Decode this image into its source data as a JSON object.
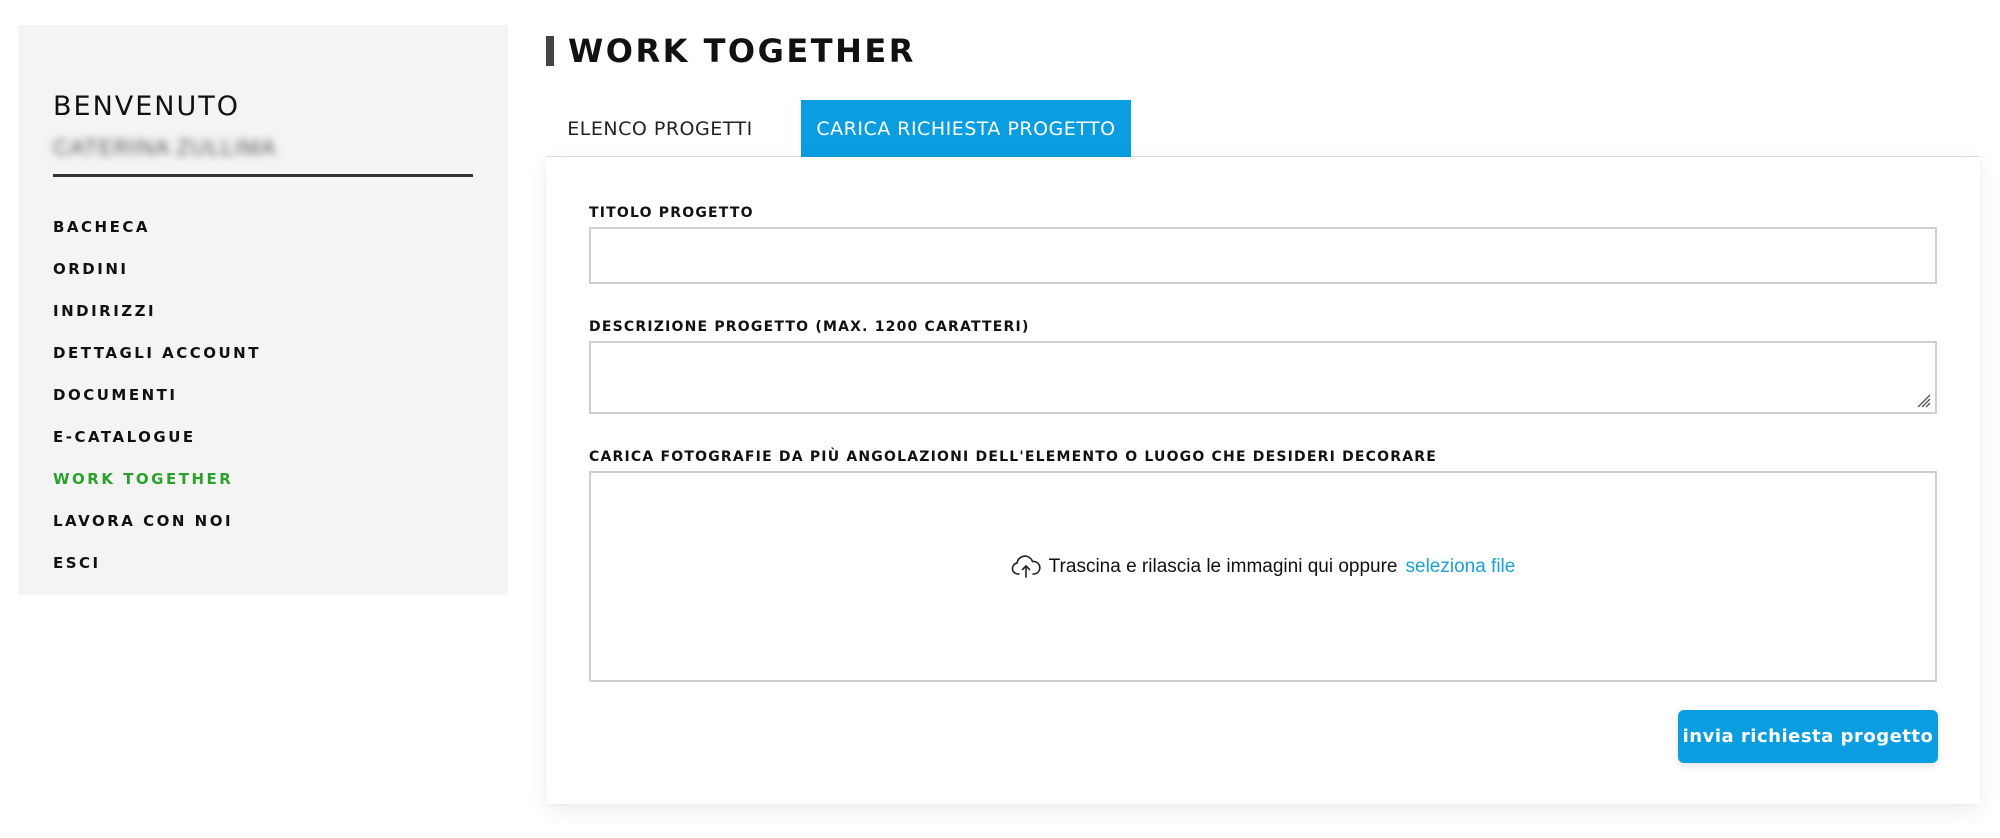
{
  "sidebar": {
    "welcome": "BENVENUTO",
    "username": "CATERINA ZULLIMA",
    "items": [
      {
        "label": "BACHECA",
        "active": false
      },
      {
        "label": "ORDINI",
        "active": false
      },
      {
        "label": "INDIRIZZI",
        "active": false
      },
      {
        "label": "DETTAGLI ACCOUNT",
        "active": false
      },
      {
        "label": "DOCUMENTI",
        "active": false
      },
      {
        "label": "E-CATALOGUE",
        "active": false
      },
      {
        "label": "WORK TOGETHER",
        "active": true
      },
      {
        "label": "LAVORA CON NOI",
        "active": false
      },
      {
        "label": "ESCI",
        "active": false
      }
    ]
  },
  "main": {
    "title": "WORK TOGETHER",
    "tabs": [
      {
        "label": "ELENCO PROGETTI",
        "active": false
      },
      {
        "label": "CARICA RICHIESTA PROGETTO",
        "active": true
      }
    ],
    "form": {
      "title_label": "TITOLO PROGETTO",
      "title_value": "",
      "description_label": "DESCRIZIONE PROGETTO (MAX. 1200 CARATTERI)",
      "description_value": "",
      "photos_label": "CARICA FOTOGRAFIE DA PIÙ ANGOLAZIONI DELL'ELEMENTO O LUOGO CHE DESIDERI DECORARE",
      "dropzone_text": "Trascina e rilascia le immagini qui oppure",
      "dropzone_link": "seleziona file",
      "submit_label": "invia richiesta progetto"
    }
  },
  "colors": {
    "accent": "#0a9de0",
    "active_nav": "#2aa12a",
    "link": "#1aa0d6",
    "sidebar_bg": "#f4f4f4"
  },
  "icons": {
    "upload": "cloud-upload-icon"
  }
}
